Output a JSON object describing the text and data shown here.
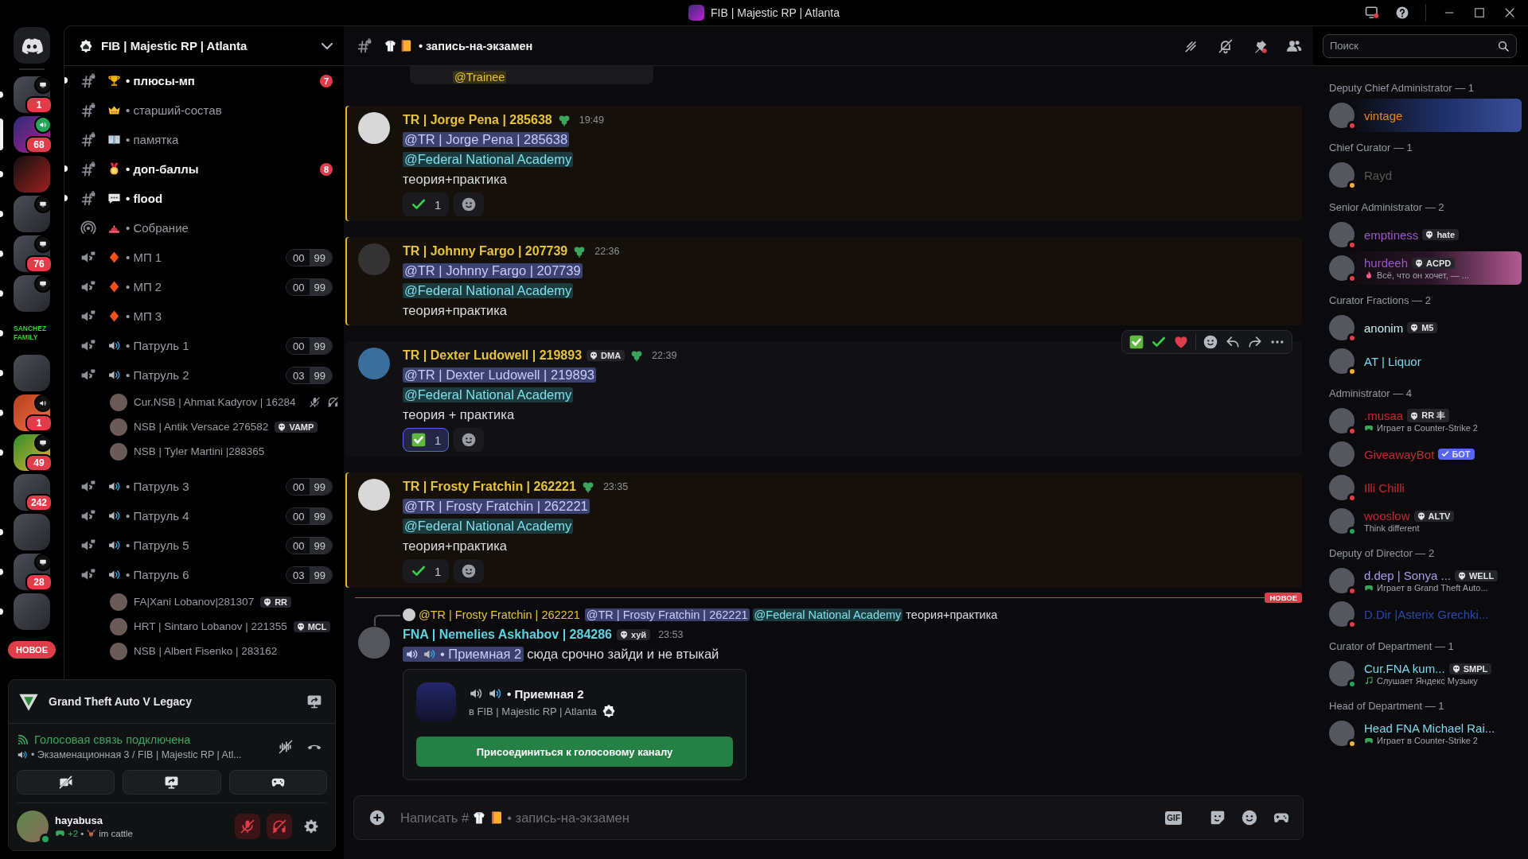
{
  "titlebar": {
    "title": "FIB | Majestic RP | Atlanta"
  },
  "servers": [
    {
      "badge": "1",
      "kind": "screen",
      "unread": true,
      "selected": false
    },
    {
      "badge": "68",
      "kind": "voice-live",
      "selected": true
    },
    {
      "kind": "plain",
      "unread": true,
      "selected": false
    },
    {
      "kind": "screen",
      "unread": true,
      "selected": false
    },
    {
      "badge": "76",
      "kind": "screen",
      "unread": true,
      "selected": false
    },
    {
      "kind": "screen",
      "unread": true,
      "selected": false
    },
    {
      "label": "SANCHEZ FAMILY",
      "kind": "plain",
      "unread": true,
      "selected": false
    },
    {
      "kind": "plain",
      "unread": true,
      "selected": false
    },
    {
      "badge": "1",
      "kind": "voice",
      "unread": true,
      "selected": false
    },
    {
      "badge": "49",
      "kind": "screen",
      "unread": true,
      "selected": false
    },
    {
      "badge": "242",
      "kind": "plain",
      "unread": false,
      "selected": false
    },
    {
      "kind": "plain",
      "unread": true,
      "selected": false
    },
    {
      "badge": "28",
      "kind": "screen",
      "unread": true,
      "selected": false
    },
    {
      "kind": "plain",
      "unread": true,
      "selected": false
    }
  ],
  "new_pill": "НОВОЕ",
  "server": {
    "name": "FIB | Majestic RP | Atlanta"
  },
  "channels": [
    {
      "kind": "text",
      "emoji": {
        "kind": "trophy"
      },
      "name": "• плюсы-мп",
      "unread": true,
      "mentions": "7"
    },
    {
      "kind": "text",
      "emoji": {
        "kind": "crown"
      },
      "name": "• старший-состав",
      "unread": false
    },
    {
      "kind": "text",
      "emoji": {
        "kind": "book"
      },
      "name": "• памятка",
      "unread": false
    },
    {
      "kind": "text",
      "emoji": {
        "kind": "medal"
      },
      "name": "• доп-баллы",
      "unread": true,
      "mentions": "8"
    },
    {
      "kind": "text",
      "emoji": {
        "kind": "speech"
      },
      "name": "• flood",
      "unread": true
    },
    {
      "kind": "stage",
      "emoji": {
        "kind": "siren"
      },
      "name": "• Собрание",
      "unread": false
    },
    {
      "kind": "voice",
      "emoji": {
        "kind": "diamond"
      },
      "name": "• МП 1",
      "count": "00",
      "limit": "99"
    },
    {
      "kind": "voice",
      "emoji": {
        "kind": "diamond"
      },
      "name": "• МП 2",
      "count": "00",
      "limit": "99"
    },
    {
      "kind": "voice",
      "emoji": {
        "kind": "diamond"
      },
      "name": "• МП 3"
    },
    {
      "kind": "voice",
      "emoji": {
        "kind": "speaker"
      },
      "name": "• Патруль 1",
      "count": "00",
      "limit": "99"
    },
    {
      "kind": "voice",
      "emoji": {
        "kind": "speaker"
      },
      "name": "• Патруль 2",
      "count": "03",
      "limit": "99",
      "users": [
        {
          "name": "Cur.NSB | Ahmat Kadyrov | 16284",
          "muted": true,
          "deafened": true
        },
        {
          "name": "NSB | Antik Versace 276582",
          "tag": "VAMP",
          "muted": false,
          "deafened": false
        },
        {
          "name": "NSB | Tyler Martini |288365",
          "muted": false,
          "deafened": false
        }
      ]
    },
    {
      "kind": "voice",
      "emoji": {
        "kind": "speaker"
      },
      "name": "• Патруль 3",
      "count": "00",
      "limit": "99"
    },
    {
      "kind": "voice",
      "emoji": {
        "kind": "speaker"
      },
      "name": "• Патруль 4",
      "count": "00",
      "limit": "99"
    },
    {
      "kind": "voice",
      "emoji": {
        "kind": "speaker"
      },
      "name": "• Патруль 5",
      "count": "00",
      "limit": "99"
    },
    {
      "kind": "voice",
      "emoji": {
        "kind": "speaker"
      },
      "name": "• Патруль 6",
      "count": "03",
      "limit": "99",
      "users": [
        {
          "name": "FA|Xani Lobanov|281307",
          "tag": "RR",
          "muted": false,
          "deafened": false
        },
        {
          "name": "HRT | Sintaro Lobanov | 221355",
          "tag": "MCL",
          "muted": false,
          "deafened": false
        },
        {
          "name": "NSB | Albert Fisenko | 283162",
          "muted": false,
          "deafened": false
        }
      ]
    }
  ],
  "voice_panel": {
    "activity": "Grand Theft Auto V Legacy",
    "status": "Голосовая связь подключена",
    "channel": "• Экзаменационная 3 / FIB | Majestic RP | Atl..."
  },
  "user": {
    "name": "hayabusa",
    "presence": {
      "kind": "online"
    },
    "games": "+2",
    "separator": "•",
    "custom_status": "im cattle",
    "mic_muted": true,
    "deafened": true
  },
  "channel_header": {
    "name": "• запись-на-экзамен"
  },
  "search": {
    "placeholder": "Поиск"
  },
  "messages": [
    {
      "kind": "embed-tail",
      "mention": "@Trainee"
    },
    {
      "kind": "message",
      "author": "TR | Jorge Pena | 285638",
      "color": "#e8c43c",
      "time": "19:49",
      "highlighted": true,
      "hovered": false,
      "lines": [
        [
          {
            "kind": "mention",
            "text": "@TR | Jorge Pena | 285638"
          }
        ],
        [
          {
            "kind": "role",
            "text": "@Federal National Academy"
          }
        ],
        [
          {
            "kind": "text",
            "text": "теория+практика"
          }
        ]
      ],
      "reactions": [
        {
          "emoji": {
            "kind": "check"
          },
          "count": "1",
          "selected": false
        }
      ]
    },
    {
      "kind": "message",
      "author": "TR | Johnny Fargo |  207739",
      "color": "#e8c43c",
      "time": "22:36",
      "highlighted": true,
      "hovered": false,
      "lines": [
        [
          {
            "kind": "mention",
            "text": "@TR | Johnny Fargo |  207739"
          }
        ],
        [
          {
            "kind": "role",
            "text": "@Federal National Academy"
          }
        ],
        [
          {
            "kind": "text",
            "text": "теория+практика"
          }
        ]
      ]
    },
    {
      "kind": "message",
      "author": "TR | Dexter Ludowell | 219893",
      "color": "#e8c43c",
      "tag": "DMA",
      "time": "22:39",
      "highlighted": false,
      "hovered": true,
      "lines": [
        [
          {
            "kind": "mention",
            "text": "@TR | Dexter Ludowell | 219893"
          }
        ],
        [
          {
            "kind": "role",
            "text": "@Federal National Academy"
          }
        ],
        [
          {
            "kind": "text",
            "text": "теория + практика"
          }
        ]
      ],
      "reactions": [
        {
          "emoji": {
            "kind": "checkbox"
          },
          "count": "1",
          "selected": true
        }
      ]
    },
    {
      "kind": "message",
      "author": "TR | Frosty Fratchin | 262221",
      "color": "#e8c43c",
      "time": "23:35",
      "highlighted": true,
      "hovered": false,
      "lines": [
        [
          {
            "kind": "mention",
            "text": "@TR | Frosty Fratchin | 262221"
          }
        ],
        [
          {
            "kind": "role",
            "text": "@Federal National Academy"
          }
        ],
        [
          {
            "kind": "text",
            "text": "теория+практика"
          }
        ]
      ],
      "reactions": [
        {
          "emoji": {
            "kind": "check"
          },
          "count": "1",
          "selected": false
        }
      ]
    },
    {
      "kind": "divider",
      "label": "НОВОЕ"
    },
    {
      "kind": "message",
      "author": "FNA | Nemelies Askhabov | 284286",
      "color": "#5ed3df",
      "tag": "хуй",
      "time": "23:53",
      "highlighted": false,
      "hovered": false,
      "reply": {
        "author": "@TR | Frosty Fratchin | 262221",
        "parts": [
          {
            "kind": "mention",
            "text": "@TR | Frosty Fratchin | 262221"
          },
          {
            "kind": "role",
            "text": "@Federal National Academy"
          },
          {
            "kind": "text",
            "text": "теория+практика"
          }
        ]
      },
      "lines": [
        [
          {
            "kind": "channel",
            "text": "• Приемная 2"
          },
          {
            "kind": "text",
            "text": "сюда срочно зайди и не втыкай"
          }
        ]
      ],
      "invite": {
        "channel": "• Приемная 2",
        "server": "в FIB | Majestic RP | Atlanta",
        "button": "Присоединиться к голосовому каналу"
      }
    }
  ],
  "composer": {
    "prompt": "Написать #",
    "channel": "• запись-на-экзамен",
    "gif": "GIF"
  },
  "member_groups": [
    {
      "title": "Deputy Chief Administrator — 1",
      "members": [
        {
          "name": "vintage",
          "color": "#e8832a",
          "presence": {
            "kind": "dnd"
          },
          "banner": {
            "kind": "space"
          }
        }
      ]
    },
    {
      "title": "Chief Curator — 1",
      "members": [
        {
          "name": "Rayd",
          "color": "#5a5a5a",
          "presence": {
            "kind": "idle"
          }
        }
      ]
    },
    {
      "title": "Senior Administrator — 2",
      "members": [
        {
          "name": "emptiness",
          "color": "#9b59c6",
          "presence": {
            "kind": "dnd"
          },
          "tag": "hate"
        },
        {
          "name": "hurdeeh",
          "color": "#9b59c6",
          "presence": {
            "kind": "dnd"
          },
          "tag": "ACPD",
          "activity": {
            "kind": "custom",
            "text": "Всё, что он хочет, — ..."
          },
          "banner": {
            "kind": "blossom"
          }
        }
      ]
    },
    {
      "title": "Curator Fractions — 2",
      "members": [
        {
          "name": "anonim",
          "color": "#c9f1f5",
          "presence": {
            "kind": "dnd"
          },
          "tag": "M5"
        },
        {
          "name": "AT | Liquor",
          "color": "#7fd9ee",
          "presence": {
            "kind": "idle"
          }
        }
      ]
    },
    {
      "title": "Administrator — 4",
      "members": [
        {
          "name": ".musaa",
          "color": "#c42a30",
          "presence": {
            "kind": "dnd"
          },
          "tag": "RR 丰",
          "activity": {
            "kind": "game",
            "text": "Играет в Counter-Strike 2"
          }
        },
        {
          "name": "GiveawayBot",
          "color": "#c42a30",
          "bot": "БОТ"
        },
        {
          "name": "Illi Chilli",
          "color": "#c42a30",
          "presence": {
            "kind": "dnd"
          }
        },
        {
          "name": "wooslow",
          "color": "#c42a30",
          "presence": {
            "kind": "online"
          },
          "tag": "ALTV",
          "activity": {
            "kind": "plain",
            "text": "Think different"
          }
        }
      ]
    },
    {
      "title": "Deputy of Director — 2",
      "members": [
        {
          "name": "d.dep | Sonya ...",
          "color": "#ab9be9",
          "presence": {
            "kind": "dnd"
          },
          "tag": "WELL",
          "activity": {
            "kind": "game",
            "text": "Играет в Grand Theft Auto..."
          }
        },
        {
          "name": "D.Dir |Asterix Grechki...",
          "color": "#2b4aa8",
          "presence": {
            "kind": "dnd"
          }
        }
      ]
    },
    {
      "title": "Curator of Department — 1",
      "members": [
        {
          "name": "Cur.FNA kum...",
          "color": "#7fd9ee",
          "presence": {
            "kind": "online"
          },
          "tag": "SMPL",
          "activity": {
            "kind": "music",
            "text": "Слушает Яндекс Музыку"
          }
        }
      ]
    },
    {
      "title": "Head of Department — 1",
      "members": [
        {
          "name": "Head FNA Michael Rai...",
          "color": "#7fd9ee",
          "presence": {
            "kind": "idle"
          },
          "activity": {
            "kind": "game",
            "text": "Играет в Counter-Strike 2"
          }
        }
      ]
    }
  ]
}
